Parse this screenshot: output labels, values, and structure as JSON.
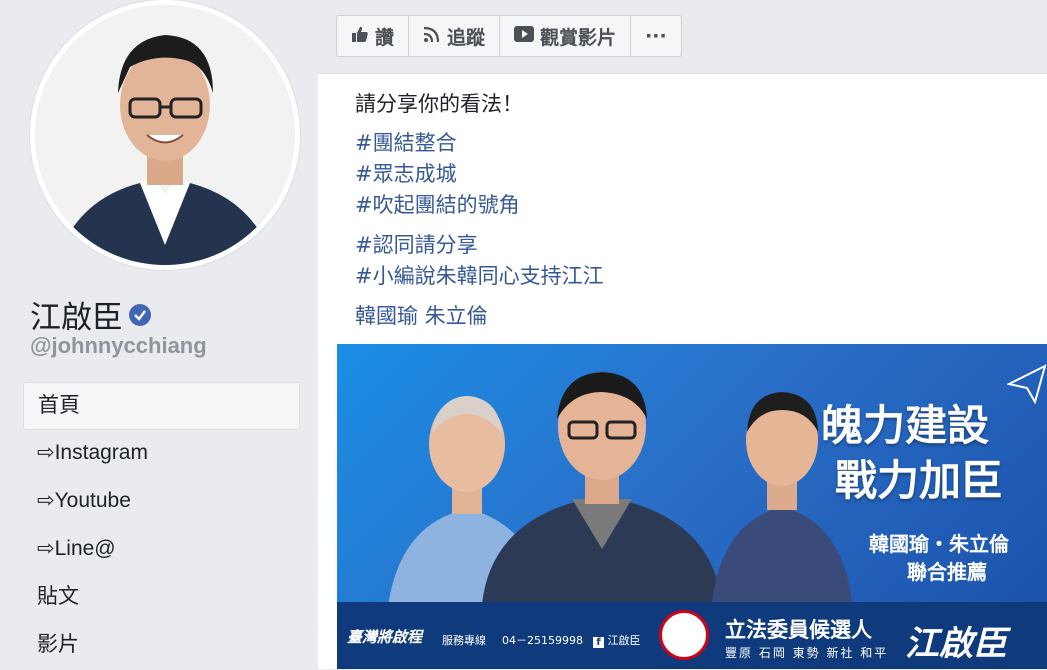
{
  "profile": {
    "name": "江啟臣",
    "handle": "@johnnycchiang",
    "verified": true,
    "avatar": "profile-photo"
  },
  "nav": {
    "items": [
      {
        "label": "首頁",
        "active": true
      },
      {
        "label": "⇨Instagram",
        "active": false
      },
      {
        "label": "⇨Youtube",
        "active": false
      },
      {
        "label": "⇨Line@",
        "active": false
      },
      {
        "label": "貼文",
        "active": false
      },
      {
        "label": "影片",
        "active": false
      }
    ]
  },
  "action_bar": {
    "like": {
      "label": "讚",
      "icon": "thumbs-up-icon"
    },
    "follow": {
      "label": "追蹤",
      "icon": "rss-icon"
    },
    "watch": {
      "label": "觀賞影片",
      "icon": "play-icon"
    },
    "more": {
      "label": "···"
    }
  },
  "post": {
    "intro": "請分享你的看法！",
    "hashtags_group1": [
      "#團結整合",
      "#眾志成城",
      "#吹起團結的號角"
    ],
    "hashtags_group2": [
      "#認同請分享",
      "#小編說朱韓同心支持江江"
    ],
    "mentions": "韓國瑜 朱立倫"
  },
  "banner": {
    "slogan_line1": "魄力建設",
    "slogan_line2": "戰力加臣",
    "endorse_line1": "韓國瑜・朱立倫",
    "endorse_line2": "聯合推薦",
    "brand": "臺灣將啟程",
    "service_label": "服務專線",
    "phone": "04－25159998",
    "fb_name": "江啟臣",
    "role": "立法委員候選人",
    "districts": "豐原 石岡 東勢 新社 和平",
    "candidate_name": "江啟臣",
    "colors": {
      "primary": "#1b8ee6",
      "footer": "#0f3b7c",
      "accent": "#d0021b"
    }
  }
}
